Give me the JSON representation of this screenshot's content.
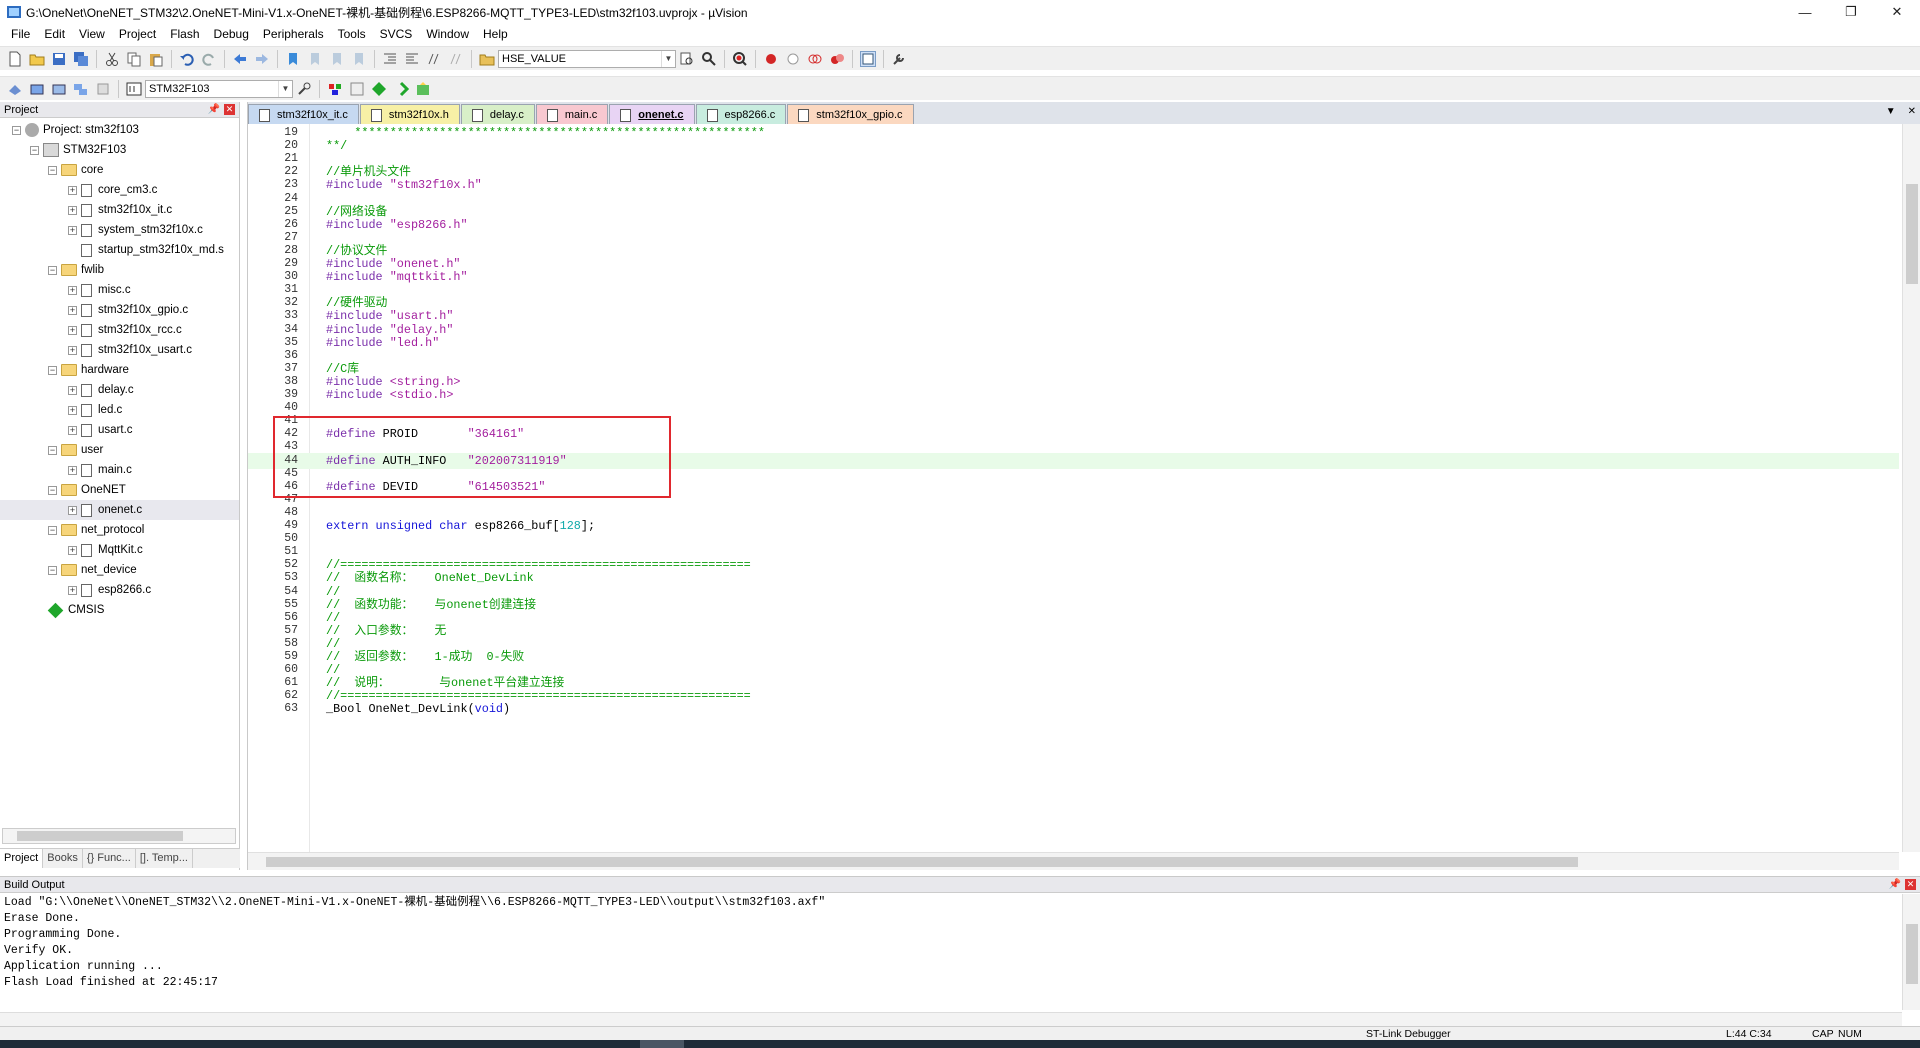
{
  "window": {
    "title": "G:\\OneNet\\OneNET_STM32\\2.OneNET-Mini-V1.x-OneNET-裸机-基础例程\\6.ESP8266-MQTT_TYPE3-LED\\stm32f103.uvprojx - µVision",
    "minimize": "—",
    "restore": "❐",
    "close": "✕"
  },
  "menu": [
    "File",
    "Edit",
    "View",
    "Project",
    "Flash",
    "Debug",
    "Peripherals",
    "Tools",
    "SVCS",
    "Window",
    "Help"
  ],
  "toolbar": {
    "find_combo_value": "HSE_VALUE",
    "target_combo_value": "STM32F103"
  },
  "project_pane": {
    "header": "Project",
    "pin": "📌",
    "close": "✕",
    "tree": [
      {
        "label": "Project: stm32f103",
        "level": 0,
        "type": "project",
        "expanded": true
      },
      {
        "label": "STM32F103",
        "level": 1,
        "type": "target",
        "expanded": true
      },
      {
        "label": "core",
        "level": 2,
        "type": "folder",
        "expanded": true
      },
      {
        "label": "core_cm3.c",
        "level": 3,
        "type": "file",
        "plus": true
      },
      {
        "label": "stm32f10x_it.c",
        "level": 3,
        "type": "file",
        "plus": true
      },
      {
        "label": "system_stm32f10x.c",
        "level": 3,
        "type": "file",
        "plus": true
      },
      {
        "label": "startup_stm32f10x_md.s",
        "level": 3,
        "type": "file",
        "plus": false
      },
      {
        "label": "fwlib",
        "level": 2,
        "type": "folder",
        "expanded": true
      },
      {
        "label": "misc.c",
        "level": 3,
        "type": "file",
        "plus": true
      },
      {
        "label": "stm32f10x_gpio.c",
        "level": 3,
        "type": "file",
        "plus": true
      },
      {
        "label": "stm32f10x_rcc.c",
        "level": 3,
        "type": "file",
        "plus": true
      },
      {
        "label": "stm32f10x_usart.c",
        "level": 3,
        "type": "file",
        "plus": true
      },
      {
        "label": "hardware",
        "level": 2,
        "type": "folder",
        "expanded": true
      },
      {
        "label": "delay.c",
        "level": 3,
        "type": "file",
        "plus": true
      },
      {
        "label": "led.c",
        "level": 3,
        "type": "file",
        "plus": true
      },
      {
        "label": "usart.c",
        "level": 3,
        "type": "file",
        "plus": true
      },
      {
        "label": "user",
        "level": 2,
        "type": "folder",
        "expanded": true
      },
      {
        "label": "main.c",
        "level": 3,
        "type": "file",
        "plus": true
      },
      {
        "label": "OneNET",
        "level": 2,
        "type": "folder",
        "expanded": true
      },
      {
        "label": "onenet.c",
        "level": 3,
        "type": "file",
        "plus": true,
        "selected": true
      },
      {
        "label": "net_protocol",
        "level": 2,
        "type": "folder",
        "expanded": true
      },
      {
        "label": "MqttKit.c",
        "level": 3,
        "type": "file",
        "plus": true
      },
      {
        "label": "net_device",
        "level": 2,
        "type": "folder",
        "expanded": true
      },
      {
        "label": "esp8266.c",
        "level": 3,
        "type": "file",
        "plus": true
      },
      {
        "label": "CMSIS",
        "level": 2,
        "type": "cmsis",
        "expanded": false
      }
    ],
    "tabs": [
      {
        "label": "Project",
        "active": true
      },
      {
        "label": "Books",
        "active": false
      },
      {
        "label": "{} Func...",
        "active": false
      },
      {
        "label": "[]. Temp...",
        "active": false
      }
    ]
  },
  "editor": {
    "tabs": [
      {
        "label": "stm32f10x_it.c",
        "color": "#c6d9f1",
        "active": false
      },
      {
        "label": "stm32f10x.h",
        "color": "#f7f0a6",
        "active": false
      },
      {
        "label": "delay.c",
        "color": "#d8efc8",
        "active": false
      },
      {
        "label": "main.c",
        "color": "#f8c8d0",
        "active": false
      },
      {
        "label": "onenet.c",
        "color": "#e8d4f4",
        "active": true
      },
      {
        "label": "esp8266.c",
        "color": "#c8ecdf",
        "active": false
      },
      {
        "label": "stm32f10x_gpio.c",
        "color": "#fbd8c0",
        "active": false
      }
    ],
    "highlighted_line": 44,
    "lines": [
      {
        "n": "19",
        "tokens": [
          {
            "c": "cm",
            "t": "    **********************************************************"
          }
        ]
      },
      {
        "n": "20",
        "tokens": [
          {
            "c": "cm",
            "t": "**/"
          }
        ]
      },
      {
        "n": "21",
        "tokens": []
      },
      {
        "n": "22",
        "tokens": [
          {
            "c": "cm",
            "t": "//单片机头文件"
          }
        ]
      },
      {
        "n": "23",
        "tokens": [
          {
            "c": "pp",
            "t": "#include "
          },
          {
            "c": "st",
            "t": "\"stm32f10x.h\""
          }
        ]
      },
      {
        "n": "24",
        "tokens": []
      },
      {
        "n": "25",
        "tokens": [
          {
            "c": "cm",
            "t": "//网络设备"
          }
        ]
      },
      {
        "n": "26",
        "tokens": [
          {
            "c": "pp",
            "t": "#include "
          },
          {
            "c": "st",
            "t": "\"esp8266.h\""
          }
        ]
      },
      {
        "n": "27",
        "tokens": []
      },
      {
        "n": "28",
        "tokens": [
          {
            "c": "cm",
            "t": "//协议文件"
          }
        ]
      },
      {
        "n": "29",
        "tokens": [
          {
            "c": "pp",
            "t": "#include "
          },
          {
            "c": "st",
            "t": "\"onenet.h\""
          }
        ]
      },
      {
        "n": "30",
        "tokens": [
          {
            "c": "pp",
            "t": "#include "
          },
          {
            "c": "st",
            "t": "\"mqttkit.h\""
          }
        ]
      },
      {
        "n": "31",
        "tokens": []
      },
      {
        "n": "32",
        "tokens": [
          {
            "c": "cm",
            "t": "//硬件驱动"
          }
        ]
      },
      {
        "n": "33",
        "tokens": [
          {
            "c": "pp",
            "t": "#include "
          },
          {
            "c": "st",
            "t": "\"usart.h\""
          }
        ]
      },
      {
        "n": "34",
        "tokens": [
          {
            "c": "pp",
            "t": "#include "
          },
          {
            "c": "st",
            "t": "\"delay.h\""
          }
        ]
      },
      {
        "n": "35",
        "tokens": [
          {
            "c": "pp",
            "t": "#include "
          },
          {
            "c": "st",
            "t": "\"led.h\""
          }
        ]
      },
      {
        "n": "36",
        "tokens": []
      },
      {
        "n": "37",
        "tokens": [
          {
            "c": "cm",
            "t": "//C库"
          }
        ]
      },
      {
        "n": "38",
        "tokens": [
          {
            "c": "pp",
            "t": "#include "
          },
          {
            "c": "st",
            "t": "<string.h>"
          }
        ]
      },
      {
        "n": "39",
        "tokens": [
          {
            "c": "pp",
            "t": "#include "
          },
          {
            "c": "st",
            "t": "<stdio.h>"
          }
        ]
      },
      {
        "n": "40",
        "tokens": []
      },
      {
        "n": "41",
        "tokens": []
      },
      {
        "n": "42",
        "tokens": [
          {
            "c": "pp",
            "t": "#define "
          },
          {
            "c": "",
            "t": "PROID       "
          },
          {
            "c": "st",
            "t": "\"364161\""
          }
        ]
      },
      {
        "n": "43",
        "tokens": []
      },
      {
        "n": "44",
        "tokens": [
          {
            "c": "pp",
            "t": "#define "
          },
          {
            "c": "",
            "t": "AUTH_INFO   "
          },
          {
            "c": "st",
            "t": "\"202007311919\""
          }
        ]
      },
      {
        "n": "45",
        "tokens": []
      },
      {
        "n": "46",
        "tokens": [
          {
            "c": "pp",
            "t": "#define "
          },
          {
            "c": "",
            "t": "DEVID       "
          },
          {
            "c": "st",
            "t": "\"614503521\""
          }
        ]
      },
      {
        "n": "47",
        "tokens": []
      },
      {
        "n": "48",
        "tokens": []
      },
      {
        "n": "49",
        "tokens": [
          {
            "c": "kw",
            "t": "extern unsigned char "
          },
          {
            "c": "",
            "t": "esp8266_buf["
          },
          {
            "c": "nb",
            "t": "128"
          },
          {
            "c": "",
            "t": "];"
          }
        ]
      },
      {
        "n": "50",
        "tokens": []
      },
      {
        "n": "51",
        "tokens": []
      },
      {
        "n": "52",
        "tokens": [
          {
            "c": "cm",
            "t": "//=========================================================="
          }
        ]
      },
      {
        "n": "53",
        "tokens": [
          {
            "c": "cm",
            "t": "//  函数名称：   OneNet_DevLink"
          }
        ]
      },
      {
        "n": "54",
        "tokens": [
          {
            "c": "cm",
            "t": "//"
          }
        ]
      },
      {
        "n": "55",
        "tokens": [
          {
            "c": "cm",
            "t": "//  函数功能：   与onenet创建连接"
          }
        ]
      },
      {
        "n": "56",
        "tokens": [
          {
            "c": "cm",
            "t": "//"
          }
        ]
      },
      {
        "n": "57",
        "tokens": [
          {
            "c": "cm",
            "t": "//  入口参数：   无"
          }
        ]
      },
      {
        "n": "58",
        "tokens": [
          {
            "c": "cm",
            "t": "//"
          }
        ]
      },
      {
        "n": "59",
        "tokens": [
          {
            "c": "cm",
            "t": "//  返回参数：   1-成功  0-失败"
          }
        ]
      },
      {
        "n": "60",
        "tokens": [
          {
            "c": "cm",
            "t": "//"
          }
        ]
      },
      {
        "n": "61",
        "tokens": [
          {
            "c": "cm",
            "t": "//  说明：       与onenet平台建立连接"
          }
        ]
      },
      {
        "n": "62",
        "tokens": [
          {
            "c": "cm",
            "t": "//=========================================================="
          }
        ]
      },
      {
        "n": "63",
        "tokens": [
          {
            "c": "",
            "t": "_Bool OneNet_DevLink("
          },
          {
            "c": "kw",
            "t": "void"
          },
          {
            "c": "",
            "t": ")"
          }
        ]
      }
    ]
  },
  "build_output": {
    "header": "Build Output",
    "lines": [
      "Load \"G:\\\\OneNet\\\\OneNET_STM32\\\\2.OneNET-Mini-V1.x-OneNET-裸机-基础例程\\\\6.ESP8266-MQTT_TYPE3-LED\\\\output\\\\stm32f103.axf\"",
      "Erase Done.",
      "Programming Done.",
      "Verify OK.",
      "Application running ...",
      "Flash Load finished at 22:45:17"
    ]
  },
  "status_bar": {
    "debugger": "ST-Link Debugger",
    "cursor": "L:44 C:34",
    "caps": "CAP",
    "num": "NUM"
  },
  "colors": {
    "highlight_line": "#e8fbe8",
    "annotation_box": "#e0282e",
    "comment": "#0a9a0a",
    "preprocessor": "#7a2faa",
    "string": "#a31f9e",
    "keyword": "#1515d8"
  }
}
